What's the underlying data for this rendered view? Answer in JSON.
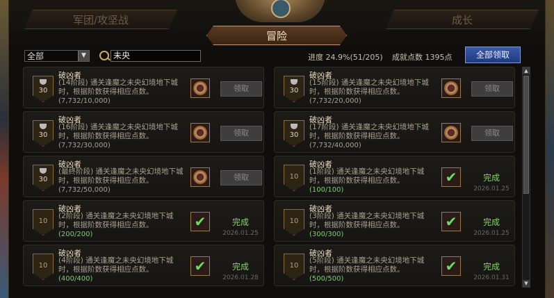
{
  "tabs": {
    "left": "军团/攻坚战",
    "active": "冒险",
    "right": "成长"
  },
  "filter": {
    "selected": "全部",
    "search_value": "未央"
  },
  "progress": "进度 24.9%(51/205)",
  "points": "成就点数 1395点",
  "claim_all": "全部领取",
  "items": [
    {
      "title": "破凶者",
      "desc": "(14阶段) 通关逢魔之未央幻境地下城时，根据阶数获得相应点数。",
      "count": "(7,732/10,000)",
      "badge": "30",
      "status": "claim",
      "claim_label": "领取"
    },
    {
      "title": "破凶者",
      "desc": "(15阶段) 通关逢魔之未央幻境地下城时，根据阶数获得相应点数。",
      "count": "(7,732/20,000)",
      "badge": "30",
      "status": "claim",
      "claim_label": "领取"
    },
    {
      "title": "破凶者",
      "desc": "(16阶段) 通关逢魔之未央幻境地下城时，根据阶数获得相应点数。",
      "count": "(7,732/30,000)",
      "badge": "30",
      "status": "claim",
      "claim_label": "领取"
    },
    {
      "title": "破凶者",
      "desc": "(17阶段) 通关逢魔之未央幻境地下城时，根据阶数获得相应点数。",
      "count": "(7,732/40,000)",
      "badge": "30",
      "status": "claim",
      "claim_label": "领取"
    },
    {
      "title": "破凶者",
      "desc": "(最终阶段) 通关逢魔之未央幻境地下城时，根据阶数获得相应点数。",
      "count": "(7,732/50,000)",
      "badge": "30",
      "status": "claim",
      "claim_label": "领取"
    },
    {
      "title": "破凶者",
      "desc": "(1阶段) 通关逢魔之未央幻境地下城时，根据阶数获得相应点数。",
      "count": "(100/100)",
      "badge": "10",
      "status": "done",
      "done_label": "完成",
      "date": "2026.01.25"
    },
    {
      "title": "破凶者",
      "desc": "(2阶段) 通关逢魔之未央幻境地下城时，根据阶数获得相应点数。",
      "count": "(200/200)",
      "badge": "10",
      "status": "done",
      "done_label": "完成",
      "date": "2026.01.25"
    },
    {
      "title": "破凶者",
      "desc": "(3阶段) 通关逢魔之未央幻境地下城时，根据阶数获得相应点数。",
      "count": "(300/300)",
      "badge": "10",
      "status": "done",
      "done_label": "完成",
      "date": "2026.01.25"
    },
    {
      "title": "破凶者",
      "desc": "(4阶段) 通关逢魔之未央幻境地下城时，根据阶数获得相应点数。",
      "count": "(400/400)",
      "badge": "10",
      "status": "done",
      "done_label": "完成",
      "date": "2026.01.28"
    },
    {
      "title": "破凶者",
      "desc": "(5阶段) 通关逢魔之未央幻境地下城时，根据阶数获得相应点数。",
      "count": "(500/500)",
      "badge": "10",
      "status": "done",
      "done_label": "完成",
      "date": "2026.01.31"
    }
  ]
}
